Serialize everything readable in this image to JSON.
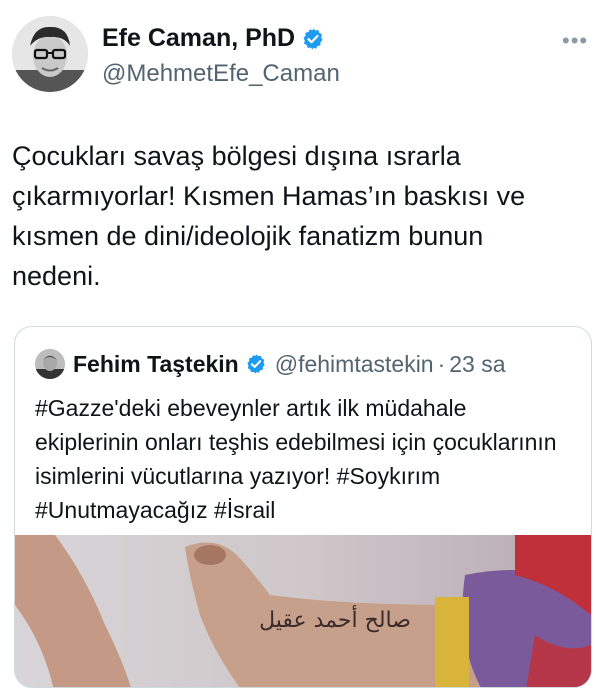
{
  "author": {
    "name": "Efe Caman, PhD",
    "handle": "@MehmetEfe_Caman",
    "verified": true
  },
  "more_label": "•••",
  "tweet": {
    "text": "Çocukları savaş bölgesi dışına ısrarla çıkarmıyorlar! Kısmen Hamas’ın baskısı ve kısmen de dini/ideolojik fanatizm bunun nedeni."
  },
  "quote": {
    "name": "Fehim Taştekin",
    "handle": "@fehimtastekin",
    "separator": "·",
    "time": "23 sa",
    "verified": true,
    "text": "#Gazze'deki ebeveynler artık ilk müdahale ekiplerinin onları teşhis edebilmesi için çocuklarının isimlerini vücutlarına yazıyor! #Soykırım #Unutmayacağız #İsrail",
    "media_caption": "صالح أحمد عقيل"
  },
  "colors": {
    "verified_blue": "#1d9bf0",
    "secondary_text": "#536471",
    "border": "#cfd9de"
  }
}
